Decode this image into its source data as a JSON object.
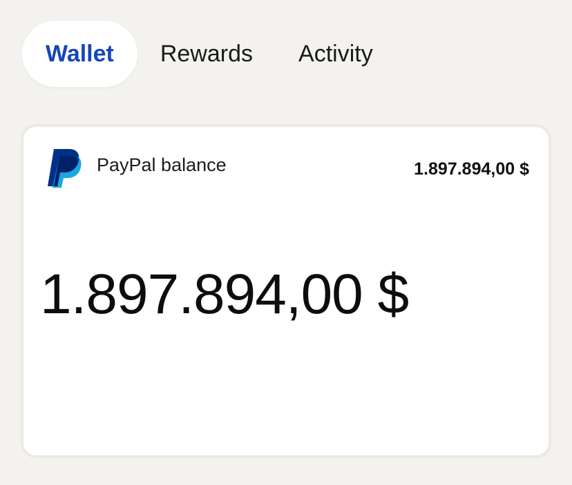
{
  "tabs": [
    {
      "label": "Wallet",
      "active": true
    },
    {
      "label": "Rewards",
      "active": false
    },
    {
      "label": "Activity",
      "active": false
    }
  ],
  "balance_card": {
    "icon": "paypal-logo-icon",
    "account_name": "PayPal balance",
    "header_amount": "1.897.894,00 $",
    "main_amount": "1.897.894,00 $"
  },
  "colors": {
    "background": "#f4f2ee",
    "active_tab_text": "#1646b8",
    "paypal_dark_blue": "#003087",
    "paypal_light_blue": "#009cde"
  }
}
